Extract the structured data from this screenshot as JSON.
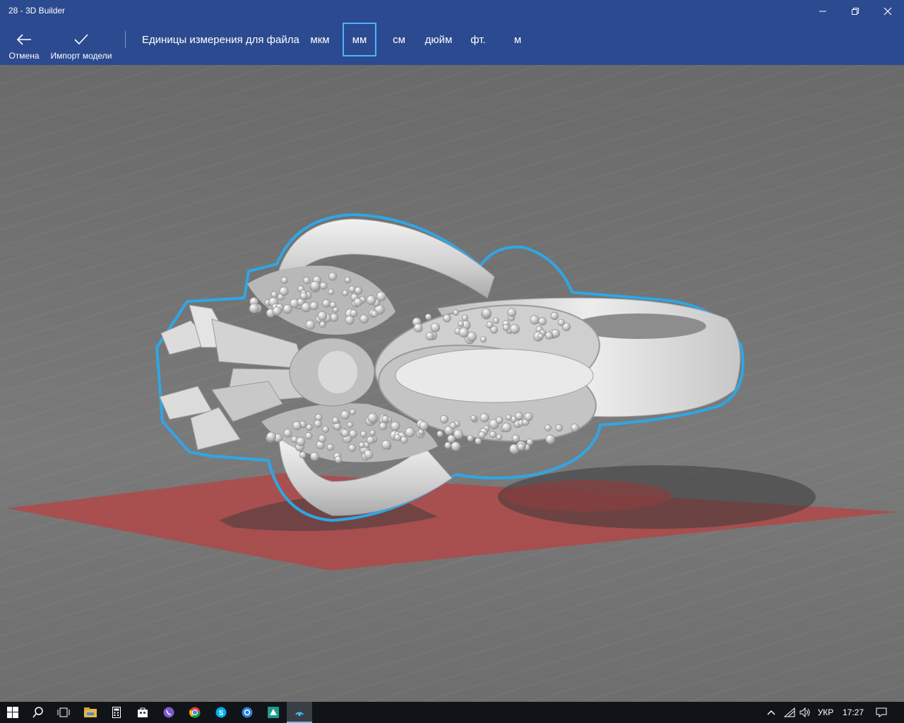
{
  "window": {
    "title": "28 - 3D Builder"
  },
  "toolbar": {
    "cancel_label": "Отмена",
    "import_label": "Импорт модели",
    "units_label": "Единицы измерения для файла",
    "units": [
      "мкм",
      "мм",
      "см",
      "дюйм",
      "фт.",
      "м"
    ],
    "selected_unit": "мм"
  },
  "viewport": {
    "accent_color": "#2fa6e6",
    "platform_color": "#b04848"
  },
  "taskbar": {
    "apps": [
      "start-icon",
      "search-icon",
      "task-view-icon",
      "file-explorer-icon",
      "calculator-icon",
      "store-icon",
      "viber-icon",
      "chrome-icon",
      "skype-icon",
      "browser-icon",
      "app-icon",
      "3d-builder-icon"
    ],
    "language": "УКР",
    "time": "17:27"
  }
}
